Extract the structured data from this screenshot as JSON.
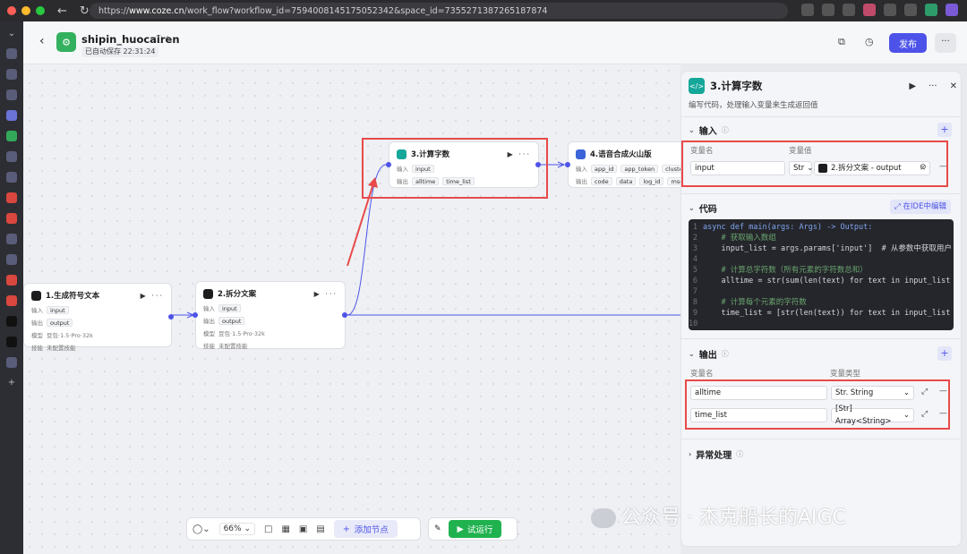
{
  "browser": {
    "url_prefix": "https://",
    "url_host": "www.coze.cn",
    "url_path": "/work_flow?workflow_id=7594008145175052342&space_id=7355271387265187874"
  },
  "header": {
    "app_name": "shipin_huocairen",
    "save_status": "已自动保存 22:31:24",
    "publish_label": "发布",
    "more_label": "···"
  },
  "nodes": {
    "gen_text": {
      "title": "1.生成符号文本",
      "input_label": "输入",
      "input_tag": "input",
      "output_label": "输出",
      "output_tag": "output",
      "model_label": "模型",
      "model_value": "豆包·1.5·Pro·32k",
      "skill_label": "技能",
      "skill_value": "未配置技能"
    },
    "split_text": {
      "title": "2.拆分文案",
      "input_label": "输入",
      "input_tag": "input",
      "output_label": "输出",
      "output_tag": "output",
      "model_label": "模型",
      "model_value": "豆包·1.5·Pro·32k",
      "skill_label": "技能",
      "skill_value": "未配置技能"
    },
    "count_words": {
      "title": "3.计算字数",
      "input_label": "输入",
      "input_tag": "input",
      "output_label": "输出",
      "output_tag_1": "alltime",
      "output_tag_2": "time_list"
    },
    "tts": {
      "title": "4.语音合成火山版",
      "input_label": "输入",
      "input_tag_1": "app_id",
      "input_tag_2": "app_token",
      "input_tag_3": "cluster",
      "output_label": "输出",
      "output_tag_1": "code",
      "output_tag_2": "data",
      "output_tag_3": "log_id",
      "output_tag_4": "msg"
    }
  },
  "toolbar": {
    "zoom": "66%",
    "add_node_label": "添加节点",
    "run_label": "试运行"
  },
  "panel": {
    "title": "3.计算字数",
    "description": "编写代码，处理输入变量来生成返回值",
    "input_section": {
      "title": "输入",
      "col_name": "变量名",
      "col_value": "变量值",
      "var_name": "input",
      "type_tag": "Str",
      "ref_value": "2.拆分文案 - output"
    },
    "code_section": {
      "title": "代码",
      "ide_label": "在IDE中编辑",
      "lines": [
        {
          "n": "1",
          "t": "async def main(args: Args) -> Output:",
          "c": "kw"
        },
        {
          "n": "2",
          "t": "    # 获取输入数组",
          "c": "cm"
        },
        {
          "n": "3",
          "t": "    input_list = args.params['input']  # 从参数中获取用户",
          "c": ""
        },
        {
          "n": "4",
          "t": "",
          "c": ""
        },
        {
          "n": "5",
          "t": "    # 计算总字符数（所有元素的字符数总和）",
          "c": "cm"
        },
        {
          "n": "6",
          "t": "    alltime = str(sum(len(text) for text in input_list",
          "c": ""
        },
        {
          "n": "7",
          "t": "",
          "c": ""
        },
        {
          "n": "8",
          "t": "    # 计算每个元素的字符数",
          "c": "cm"
        },
        {
          "n": "9",
          "t": "    time_list = [str(len(text)) for text in input_list",
          "c": ""
        },
        {
          "n": "10",
          "t": "",
          "c": ""
        }
      ]
    },
    "output_section": {
      "title": "输出",
      "col_name": "变量名",
      "col_type": "变量类型",
      "rows": [
        {
          "name": "alltime",
          "type": "Str. String"
        },
        {
          "name": "time_list",
          "type": "[Str] Array<String>"
        }
      ]
    },
    "exception_section": {
      "title": "异常处理"
    }
  },
  "watermark": "公众号 · 杰克船长的AIGC"
}
